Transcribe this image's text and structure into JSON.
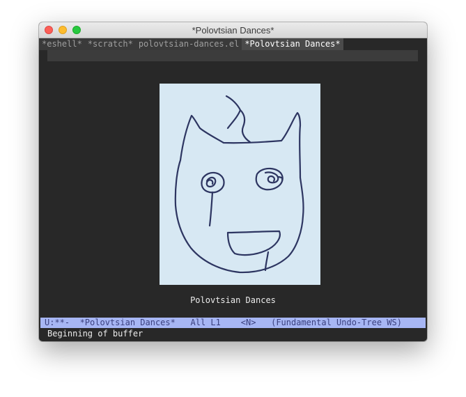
{
  "window": {
    "title": "*Polovtsian Dances*"
  },
  "tabs": [
    {
      "label": "*eshell*",
      "active": false
    },
    {
      "label": "*scratch*",
      "active": false
    },
    {
      "label": "polovtsian-dances.el",
      "active": false
    },
    {
      "label": "*Polovtsian Dances*",
      "active": true
    }
  ],
  "drawing": {
    "caption": "Polovtsian Dances",
    "background": "#d7e8f3",
    "stroke": "#2d3561"
  },
  "modeline": {
    "text": "U:**-  *Polovtsian Dances*   All L1    <N>   (Fundamental Undo-Tree WS)"
  },
  "echo_area": {
    "message": "Beginning of buffer"
  },
  "colors": {
    "frame_bg": "#282828",
    "modeline_bg": "#a7b6f4",
    "modeline_fg": "#3a3f7e"
  }
}
